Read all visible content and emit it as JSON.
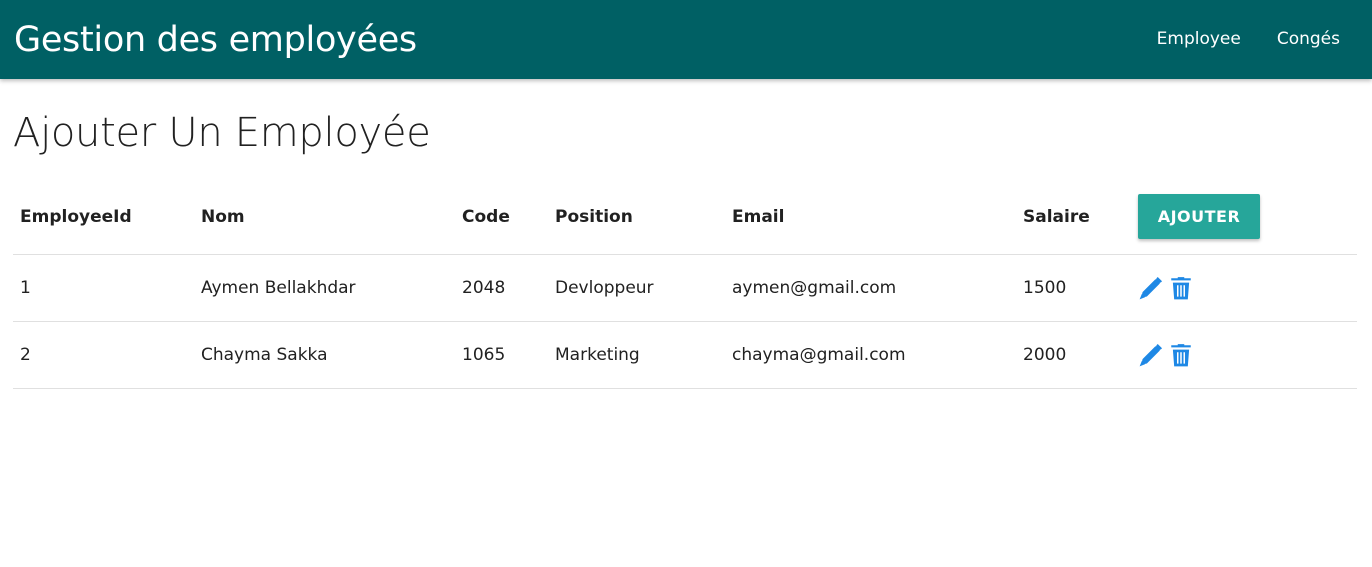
{
  "header": {
    "brand": "Gestion des employées",
    "nav": [
      "Employee",
      "Congés"
    ]
  },
  "page": {
    "title": "Ajouter Un Employée"
  },
  "table": {
    "columns": [
      "EmployeeId",
      "Nom",
      "Code",
      "Position",
      "Email",
      "Salaire"
    ],
    "add_label": "AJOUTER",
    "rows": [
      [
        "1",
        "Aymen Bellakhdar",
        "2048",
        "Devloppeur",
        "aymen@gmail.com",
        "1500"
      ],
      [
        "2",
        "Chayma Sakka",
        "1065",
        "Marketing",
        "chayma@gmail.com",
        "2000"
      ]
    ],
    "row_actions": [
      "edit-icon",
      "delete-icon"
    ]
  },
  "colors": {
    "app_bar": "#006064",
    "button": "#26a69a",
    "icon": "#1e88e5"
  }
}
